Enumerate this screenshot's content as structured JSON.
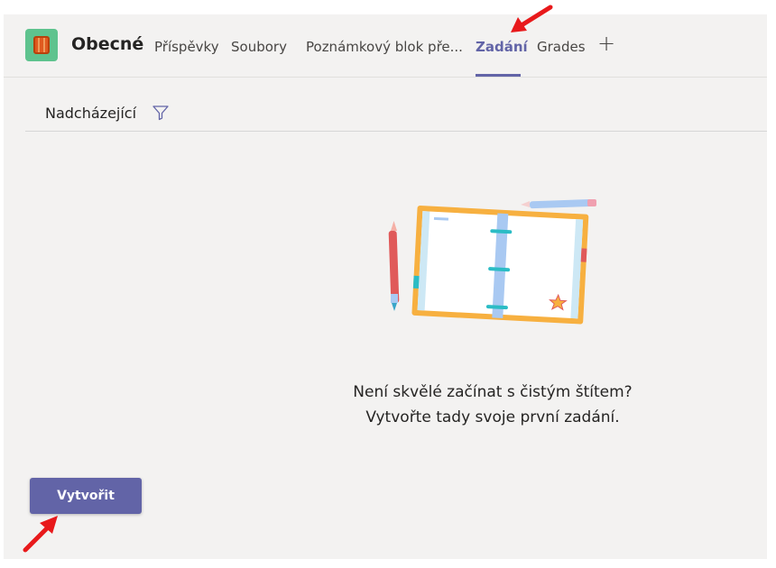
{
  "header": {
    "channel_title": "Obecné",
    "tabs": [
      {
        "label": "Příspěvky"
      },
      {
        "label": "Soubory"
      },
      {
        "label": "Poznámkový blok pře..."
      },
      {
        "label": "Zadání",
        "active": true
      },
      {
        "label": "Grades"
      }
    ],
    "add_tab_icon": "plus-icon"
  },
  "filter": {
    "label": "Nadcházející",
    "icon": "filter-icon"
  },
  "empty_state": {
    "line1": "Není skvělé začínat s čistým štítem?",
    "line2": "Vytvořte tady svoje první zadání."
  },
  "actions": {
    "create_label": "Vytvořit"
  },
  "colors": {
    "accent": "#6264a7",
    "background": "#f3f2f1",
    "annotation_arrow": "#e8191b"
  }
}
